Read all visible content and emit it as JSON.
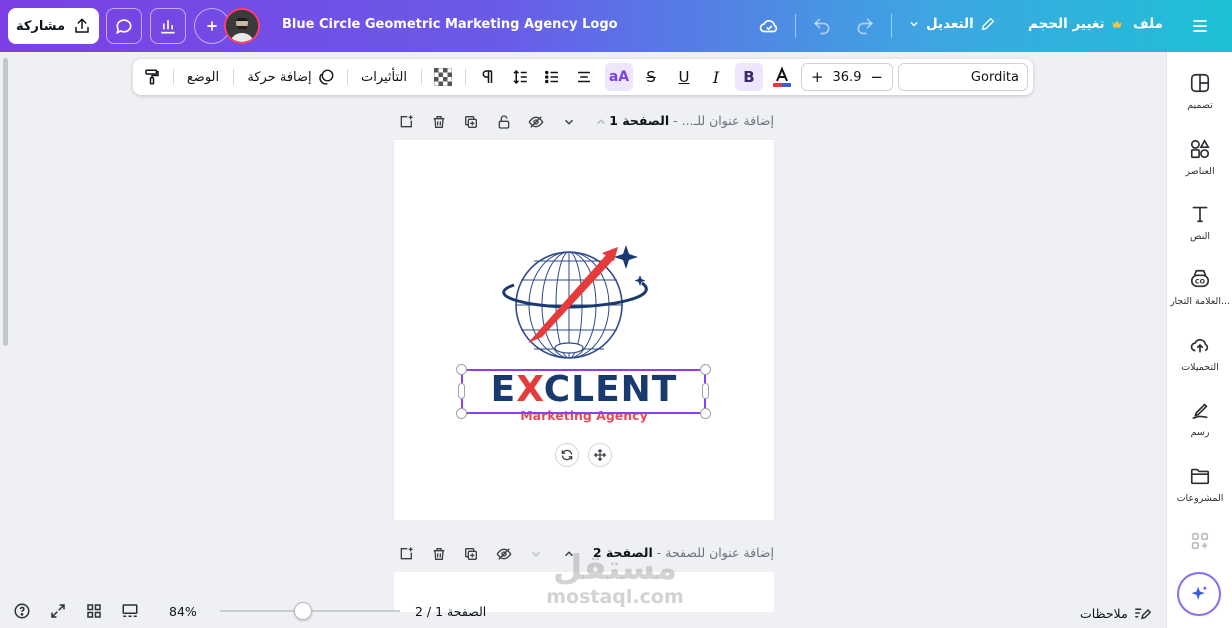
{
  "topbar": {
    "share_label": "مشاركة",
    "doc_title": "Blue Circle Geometric Marketing Agency Logo",
    "edit_label": "التعديل",
    "resize_label": "تغيير الحجم",
    "file_label": "ملف"
  },
  "text_toolbar": {
    "font_name": "Gordita",
    "font_size": "36.9",
    "plus": "+",
    "minus": "−",
    "bold": "B",
    "italic": "I",
    "underline": "U",
    "strike": "S",
    "case": "aA",
    "effects_label": "التأثيرات",
    "animate_label": "إضافة حركة",
    "position_label": "الوضع"
  },
  "page1": {
    "label": "الصفحة 1",
    "sep": " - ",
    "title_placeholder": "إضافة عنوان للـ..."
  },
  "page2": {
    "label": "الصفحة 2",
    "sep": " - ",
    "title_placeholder": "إضافة عنوان للصفحة"
  },
  "logo": {
    "main_pre": "E",
    "main_x": "X",
    "main_post": "CLENT",
    "sub": "Marketing Agency"
  },
  "sidebar": {
    "items": [
      {
        "label": "تصميم",
        "icon": "layout-icon"
      },
      {
        "label": "العناصر",
        "icon": "elements-icon"
      },
      {
        "label": "النص",
        "icon": "text-icon"
      },
      {
        "label": "العلامة التجار...",
        "icon": "brand-icon"
      },
      {
        "label": "التحميلات",
        "icon": "upload-cloud-icon"
      },
      {
        "label": "رسم",
        "icon": "draw-icon"
      },
      {
        "label": "المشروعات",
        "icon": "folder-icon"
      },
      {
        "label": "",
        "icon": "apps-icon"
      }
    ]
  },
  "bottombar": {
    "notes_label": "ملاحظات",
    "page_indicator": "الصفحة 1 / 2",
    "zoom": "84%",
    "zoom_fraction": 0.46
  },
  "watermark": {
    "arabic": "مستقل",
    "latin": "mostaql.com"
  },
  "colors": {
    "accent": "#8b3dff",
    "logo_navy": "#183a6e",
    "logo_red": "#e53b3b"
  }
}
